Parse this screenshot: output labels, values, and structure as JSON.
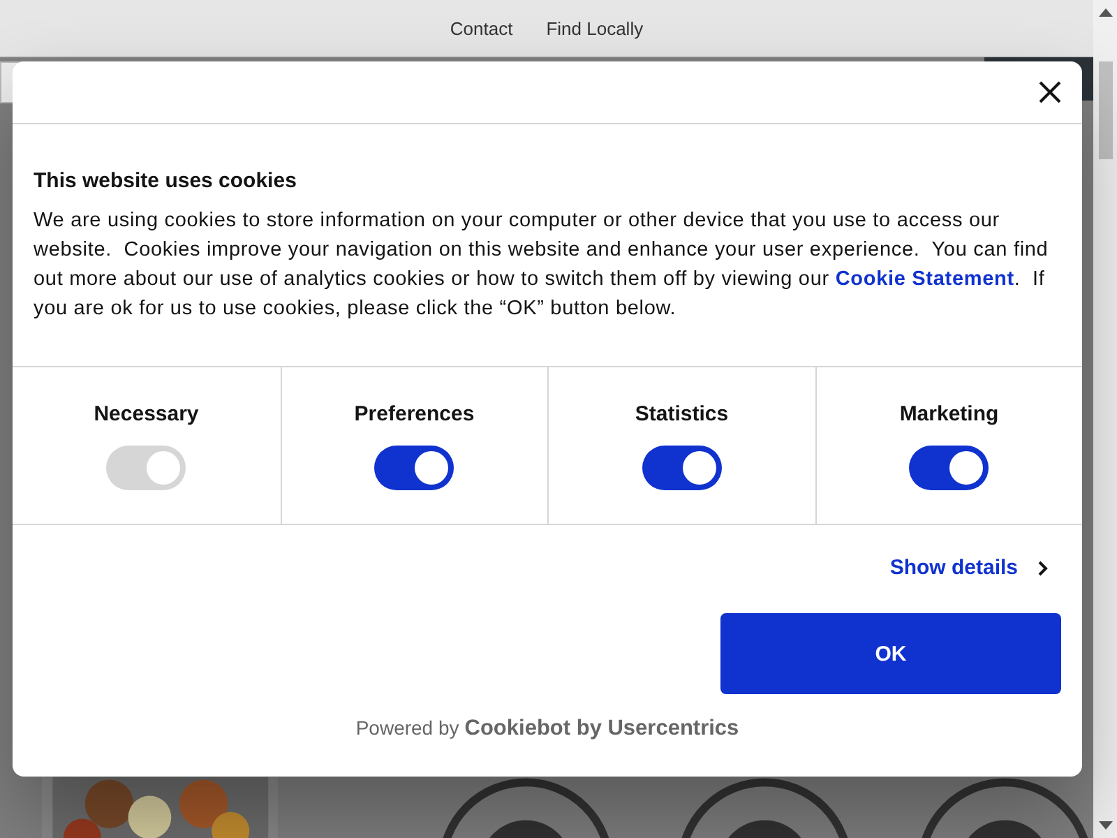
{
  "nav": {
    "links": [
      "Contact",
      "Find Locally"
    ]
  },
  "dialog": {
    "title": "This website uses cookies",
    "body": [
      {
        "kind": "text",
        "text": "We are using cookies to store information on your computer or other device that you use to access our website.  Cookies improve your navigation on this website and enhance your user experience.  You can find out more about our use of analytics cookies or how to switch them off by viewing our "
      },
      {
        "kind": "link",
        "text": "Cookie Statement"
      },
      {
        "kind": "text",
        "text": ".  If you are ok for us to use cookies, please click the “OK” button below."
      }
    ],
    "categories": [
      {
        "label": "Necessary",
        "checked": true,
        "disabled": true
      },
      {
        "label": "Preferences",
        "checked": true,
        "disabled": false
      },
      {
        "label": "Statistics",
        "checked": true,
        "disabled": false
      },
      {
        "label": "Marketing",
        "checked": true,
        "disabled": false
      }
    ],
    "details_link": "Show details",
    "ok_button": "OK",
    "powered_by": "Powered by",
    "brand": "Cookiebot by Usercentrics"
  }
}
